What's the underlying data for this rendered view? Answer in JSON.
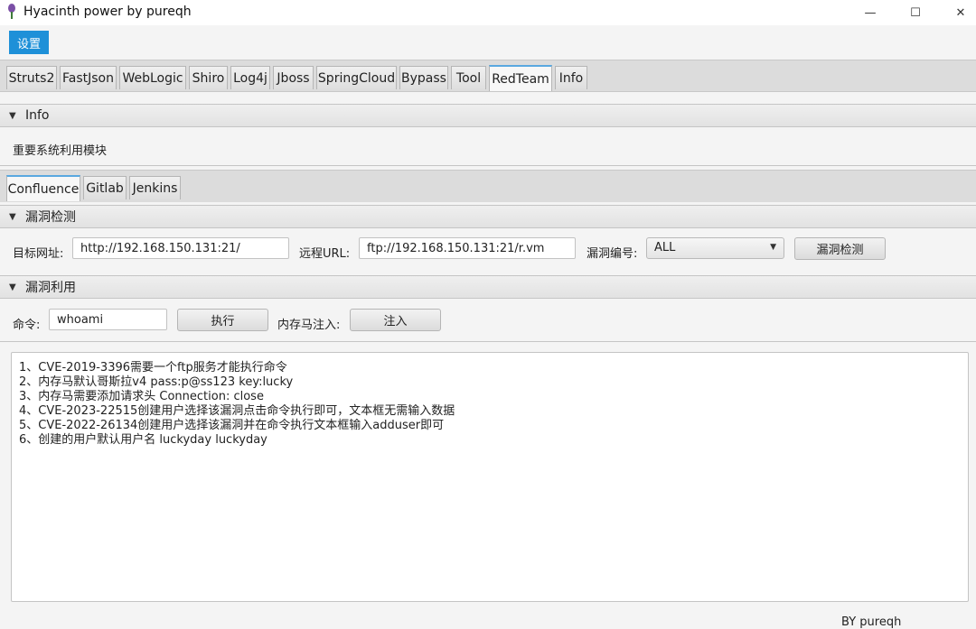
{
  "window": {
    "title": "Hyacinth power by pureqh",
    "minimize": "—",
    "maximize": "☐",
    "close": "✕"
  },
  "menu": {
    "settings": "设置"
  },
  "tabs": [
    "Struts2",
    "FastJson",
    "WebLogic",
    "Shiro",
    "Log4j",
    "Jboss",
    "SpringCloud",
    "Bypass",
    "Tool",
    "RedTeam",
    "Info"
  ],
  "active_tab": "RedTeam",
  "info_section": {
    "header": "Info",
    "text": "重要系统利用模块"
  },
  "subtabs": [
    "Confluence",
    "Gitlab",
    "Jenkins"
  ],
  "active_subtab": "Confluence",
  "detect_section": {
    "header": "漏洞检测",
    "target_label": "目标网址:",
    "target_value": "http://192.168.150.131:21/",
    "remote_label": "远程URL:",
    "remote_value": "ftp://192.168.150.131:21/r.vm",
    "vuln_label": "漏洞编号:",
    "vuln_value": "ALL",
    "detect_button": "漏洞检测"
  },
  "exploit_section": {
    "header": "漏洞利用",
    "cmd_label": "命令:",
    "cmd_value": "whoami",
    "exec_button": "执行",
    "memshell_label": "内存马注入:",
    "inject_button": "注入"
  },
  "output_lines": [
    "1、CVE-2019-3396需要一个ftp服务才能执行命令",
    "2、内存马默认哥斯拉v4 pass:p@ss123 key:lucky",
    "3、内存马需要添加请求头 Connection: close",
    "4、CVE-2023-22515创建用户选择该漏洞点击命令执行即可，文本框无需输入数据",
    "5、CVE-2022-26134创建用户选择该漏洞并在命令执行文本框输入adduser即可",
    "6、创建的用户默认用户名 luckyday luckyday"
  ],
  "footer": "BY   pureqh",
  "colors": {
    "accent": "#1e90d8",
    "active_tab_border": "#5aa8e0"
  }
}
